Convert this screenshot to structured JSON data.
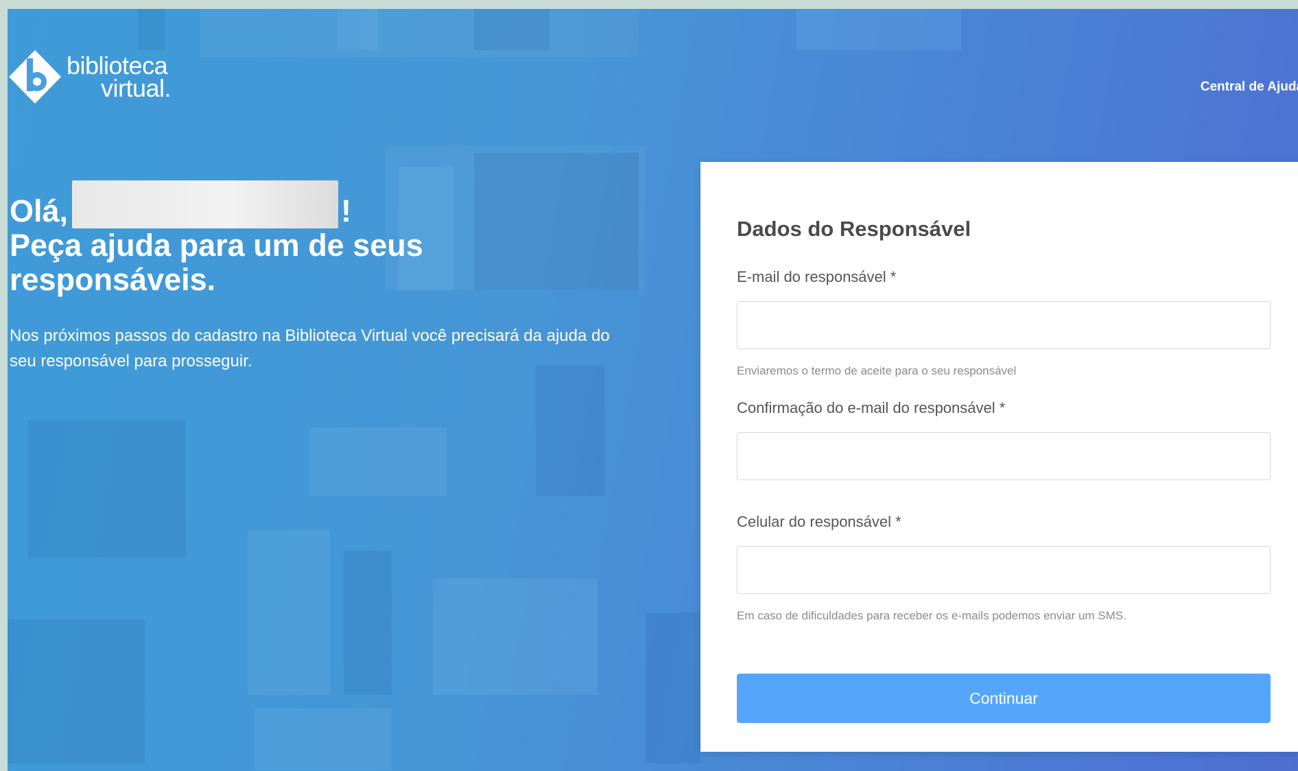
{
  "logo": {
    "line1": "biblioteca",
    "line2": "virtual."
  },
  "header": {
    "help_link": "Central de Ajuda"
  },
  "hero": {
    "greeting_prefix": "Olá,",
    "greeting_suffix": "!",
    "headline_line1": "Peça ajuda para um de seus",
    "headline_line2": "responsáveis.",
    "intro": "Nos próximos passos do cadastro na Biblioteca Virtual você precisará da ajuda do seu responsável para prosseguir."
  },
  "form": {
    "title": "Dados do Responsável",
    "email_label": "E-mail do responsável *",
    "email_hint": "Enviaremos o termo de aceite para o seu responsável",
    "email_confirm_label": "Confirmação do e-mail do responsável *",
    "phone_label": "Celular do responsável *",
    "phone_hint": "Em caso de dificuldades para receber os e-mails podemos enviar um SMS.",
    "submit_label": "Continuar"
  },
  "colors": {
    "primary_button": "#55a6fb",
    "background_start": "#3f9bd8",
    "background_end": "#4d6fd2"
  }
}
